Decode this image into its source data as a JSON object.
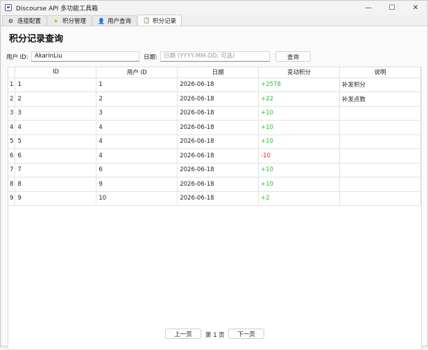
{
  "window": {
    "title": "Discourse API 多功能工具箱",
    "minimize": "—",
    "maximize": "☐",
    "close": "✕"
  },
  "tabs": [
    {
      "label": "连接配置",
      "icon": "⚙"
    },
    {
      "label": "积分管理",
      "icon": "★"
    },
    {
      "label": "用户查询",
      "icon": "👤"
    },
    {
      "label": "积分记录",
      "icon": "📋"
    }
  ],
  "page_title": "积分记录查询",
  "filters": {
    "user_id_label": "用户 ID:",
    "user_id_value": "AkarinLiu",
    "date_label": "日期:",
    "date_placeholder": "日期 (YYYY-MM-DD, 可选)",
    "query_button": "查询"
  },
  "table": {
    "columns": [
      "ID",
      "用户 ID",
      "日期",
      "变动积分",
      "说明"
    ],
    "rows": [
      {
        "n": "1",
        "id": "1",
        "user_id": "1",
        "date": "2026-06-18",
        "change": "+2578",
        "sign": "pos",
        "note": "补发积分"
      },
      {
        "n": "2",
        "id": "2",
        "user_id": "2",
        "date": "2026-06-18",
        "change": "+22",
        "sign": "pos",
        "note": "补发点数"
      },
      {
        "n": "3",
        "id": "3",
        "user_id": "3",
        "date": "2026-06-18",
        "change": "+10",
        "sign": "pos",
        "note": ""
      },
      {
        "n": "4",
        "id": "4",
        "user_id": "4",
        "date": "2026-06-18",
        "change": "+10",
        "sign": "pos",
        "note": ""
      },
      {
        "n": "5",
        "id": "5",
        "user_id": "4",
        "date": "2026-06-18",
        "change": "+10",
        "sign": "pos",
        "note": ""
      },
      {
        "n": "6",
        "id": "6",
        "user_id": "4",
        "date": "2026-06-18",
        "change": "-10",
        "sign": "neg",
        "note": ""
      },
      {
        "n": "7",
        "id": "7",
        "user_id": "6",
        "date": "2026-06-18",
        "change": "+10",
        "sign": "pos",
        "note": ""
      },
      {
        "n": "8",
        "id": "8",
        "user_id": "9",
        "date": "2026-06-18",
        "change": "+10",
        "sign": "pos",
        "note": ""
      },
      {
        "n": "9",
        "id": "9",
        "user_id": "10",
        "date": "2026-06-18",
        "change": "+2",
        "sign": "pos",
        "note": ""
      }
    ]
  },
  "pager": {
    "prev": "上一页",
    "page_label": "第 1 页",
    "next": "下一页"
  },
  "colors": {
    "positive": "#22c522",
    "negative": "#e02020"
  }
}
